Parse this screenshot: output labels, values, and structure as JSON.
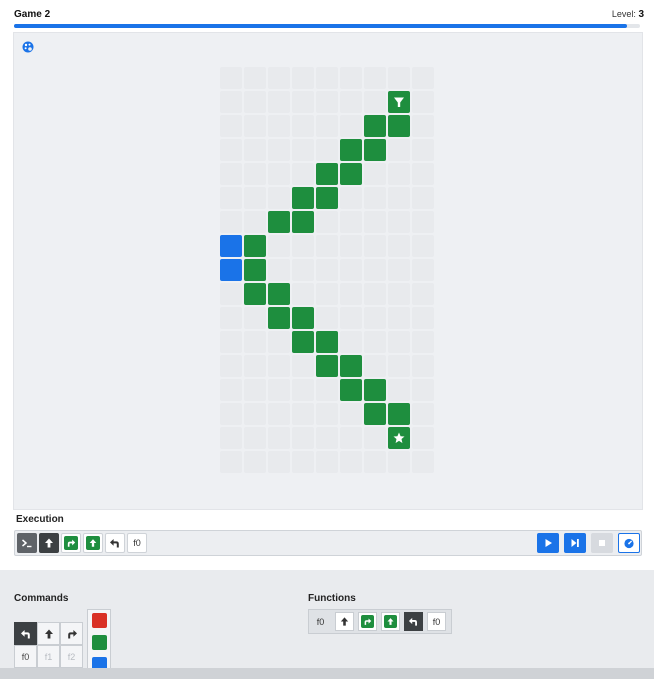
{
  "header": {
    "title": "Game 2",
    "level_label": "Level:",
    "level_value": "3",
    "progress": 0.98
  },
  "stage": {
    "palette_icon": "palette-icon",
    "grid": {
      "cols": 9,
      "rows": 17,
      "green_cells": [
        [
          7,
          1
        ],
        [
          6,
          2
        ],
        [
          7,
          2
        ],
        [
          5,
          3
        ],
        [
          6,
          3
        ],
        [
          4,
          4
        ],
        [
          5,
          4
        ],
        [
          3,
          5
        ],
        [
          4,
          5
        ],
        [
          2,
          6
        ],
        [
          3,
          6
        ],
        [
          1,
          7
        ],
        [
          1,
          8
        ],
        [
          1,
          9
        ],
        [
          2,
          9
        ],
        [
          2,
          10
        ],
        [
          3,
          10
        ],
        [
          3,
          11
        ],
        [
          4,
          11
        ],
        [
          4,
          12
        ],
        [
          5,
          12
        ],
        [
          5,
          13
        ],
        [
          6,
          13
        ],
        [
          6,
          14
        ],
        [
          7,
          14
        ],
        [
          7,
          15
        ]
      ],
      "blue_cells": [
        [
          0,
          7
        ],
        [
          0,
          8
        ]
      ],
      "start_icon": "funnel-icon",
      "goal_icon": "star-icon",
      "colors": {
        "green": "#1e8e3e",
        "blue": "#1a73e8",
        "empty": "#e8eaed"
      }
    }
  },
  "execution": {
    "label": "Execution",
    "program": [
      {
        "type": "prompt",
        "icon": "terminal-icon"
      },
      {
        "type": "dark",
        "icon": "arrow-up-icon"
      },
      {
        "type": "green",
        "icon": "turn-right-icon"
      },
      {
        "type": "green",
        "icon": "arrow-up-icon"
      },
      {
        "type": "plain",
        "icon": "turn-left-icon"
      },
      {
        "type": "text",
        "text": "f0"
      }
    ],
    "controls": [
      "play-icon",
      "step-icon",
      "stop-icon",
      "speed-icon"
    ]
  },
  "commands": {
    "label": "Commands",
    "row1": [
      "turn-left-icon",
      "arrow-up-icon",
      "turn-right-icon"
    ],
    "row2": [
      "f0",
      "f1",
      "f2"
    ],
    "colors": [
      "#d93025",
      "#1e8e3e",
      "#1a73e8"
    ]
  },
  "functions": {
    "label": "Functions",
    "name": "f0",
    "body": [
      {
        "type": "plain",
        "icon": "arrow-up-icon"
      },
      {
        "type": "green",
        "icon": "turn-right-icon"
      },
      {
        "type": "green",
        "icon": "arrow-up-icon"
      },
      {
        "type": "dark",
        "icon": "turn-left-icon"
      },
      {
        "type": "text",
        "text": "f0"
      }
    ]
  }
}
